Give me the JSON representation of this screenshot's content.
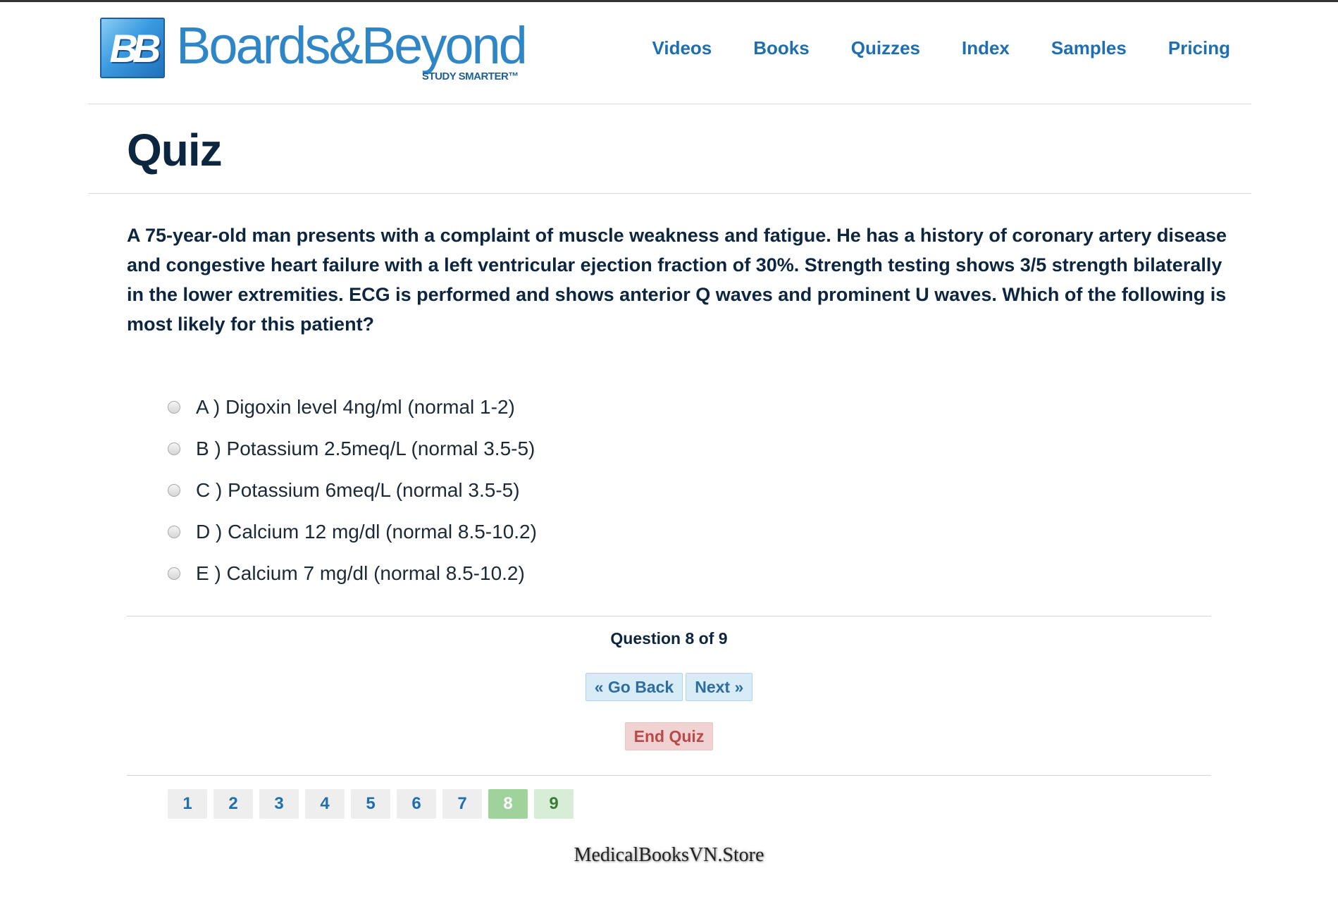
{
  "brand": {
    "logo_mark": "BB",
    "name": "Boards&Beyond",
    "tagline": "STUDY SMARTER™"
  },
  "nav": {
    "items": [
      {
        "label": "Videos"
      },
      {
        "label": "Books"
      },
      {
        "label": "Quizzes"
      },
      {
        "label": "Index"
      },
      {
        "label": "Samples"
      },
      {
        "label": "Pricing"
      }
    ]
  },
  "page": {
    "title": "Quiz"
  },
  "question": {
    "text": "A 75-year-old man presents with a complaint of muscle weakness and fatigue. He has a history of coronary artery disease and congestive heart failure with a left ventricular ejection fraction of 30%. Strength testing shows 3/5 strength bilaterally in the lower extremities. ECG is performed and shows anterior Q waves and prominent U waves. Which of the following is most likely for this patient?",
    "options": [
      {
        "label": "A ) Digoxin level 4ng/ml (normal 1-2)",
        "selected": false
      },
      {
        "label": "B ) Potassium 2.5meq/L (normal 3.5-5)",
        "selected": false
      },
      {
        "label": "C ) Potassium 6meq/L (normal 3.5-5)",
        "selected": false
      },
      {
        "label": "D ) Calcium 12 mg/dl (normal 8.5-10.2)",
        "selected": false
      },
      {
        "label": "E ) Calcium 7 mg/dl (normal 8.5-10.2)",
        "selected": false
      }
    ]
  },
  "progress": {
    "label": "Question 8 of 9",
    "current": 8,
    "total": 9
  },
  "buttons": {
    "go_back": "« Go Back",
    "next": "Next »",
    "end_quiz": "End Quiz"
  },
  "pagination": {
    "pages": [
      "1",
      "2",
      "3",
      "4",
      "5",
      "6",
      "7",
      "8",
      "9"
    ],
    "current": "8"
  },
  "watermark": "MedicalBooksVN.Store",
  "colors": {
    "link": "#1f6fb0",
    "heading": "#0d2640",
    "nav_button_bg": "#d7ecf7",
    "end_button_bg": "#f0d2d2",
    "end_button_text": "#b94a48",
    "current_page_bg": "#9fd39b"
  }
}
